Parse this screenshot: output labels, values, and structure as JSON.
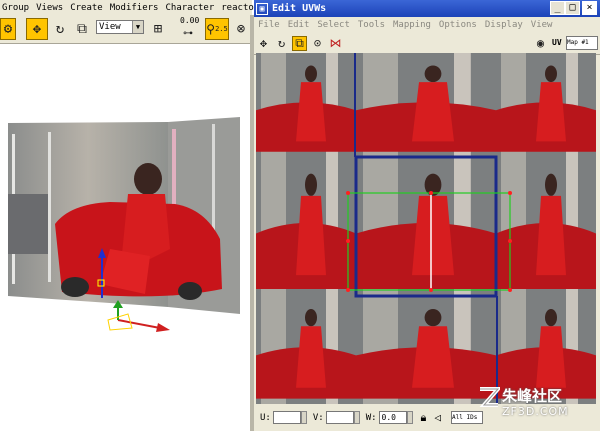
{
  "main_menu": [
    "Group",
    "Views",
    "Create",
    "Modifiers",
    "Character",
    "reactor"
  ],
  "toolbar": {
    "view_select": "View",
    "snap_value": "0.00",
    "angle_snap_value": "2.5"
  },
  "uvw_window": {
    "title": "Edit UVWs",
    "menu": [
      "File",
      "Edit",
      "Select",
      "Tools",
      "Mapping",
      "Options",
      "Display",
      "View"
    ],
    "uv_label": "UV",
    "map_dropdown": "Map #1",
    "status": {
      "u_label": "U:",
      "v_label": "V:",
      "w_label": "W:",
      "u_value": "",
      "v_value": "",
      "w_value": "0.0",
      "all_ids": "All IDs"
    }
  },
  "watermark": {
    "cn": "朱峰社区",
    "url": "ZF3D.COM"
  },
  "colors": {
    "selection_box": "#22cc22",
    "tile_border": "#1a2a8a",
    "gizmo_x": "#d02020",
    "gizmo_y": "#20a020",
    "gizmo_z": "#2030d0",
    "active_tool": "#ffc400",
    "titlebar": "#1c43b8"
  }
}
